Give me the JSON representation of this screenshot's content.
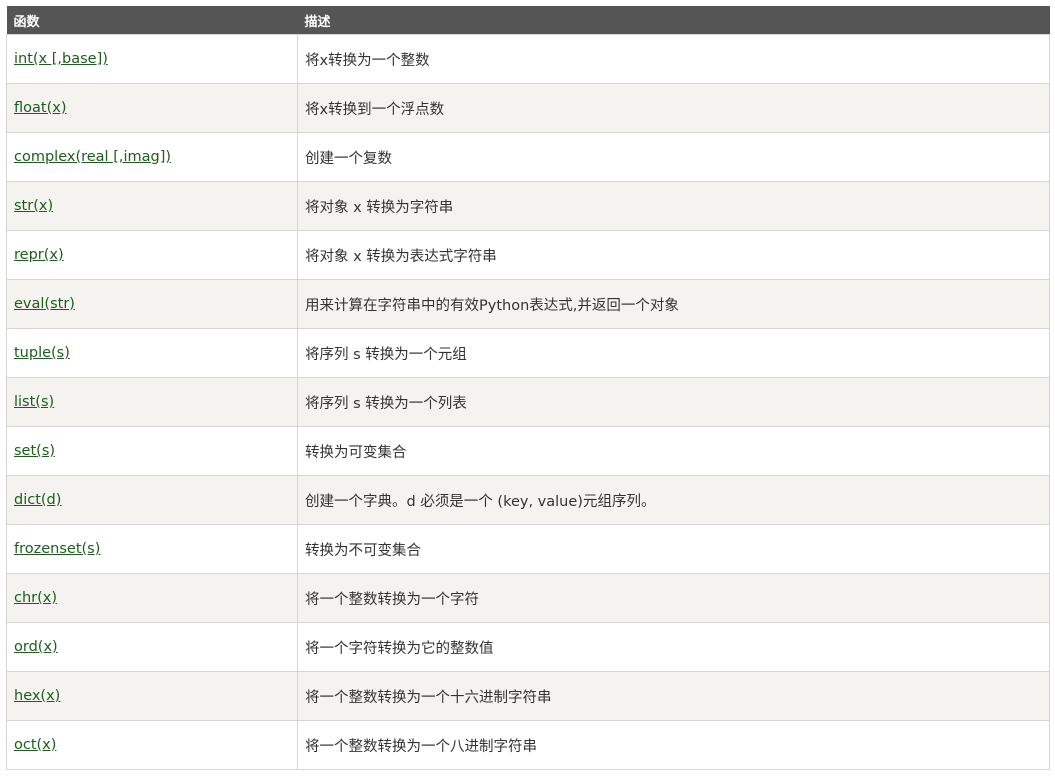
{
  "table": {
    "headers": {
      "function": "函数",
      "description": "描述"
    },
    "rows": [
      {
        "func": "int(x [,base])",
        "desc": "将x转换为一个整数"
      },
      {
        "func": "float(x)",
        "desc": "将x转换到一个浮点数"
      },
      {
        "func": "complex(real [,imag])",
        "desc": "创建一个复数"
      },
      {
        "func": "str(x)",
        "desc": "将对象 x 转换为字符串"
      },
      {
        "func": "repr(x)",
        "desc": "将对象 x 转换为表达式字符串"
      },
      {
        "func": "eval(str)",
        "desc": "用来计算在字符串中的有效Python表达式,并返回一个对象"
      },
      {
        "func": "tuple(s)",
        "desc": "将序列 s 转换为一个元组"
      },
      {
        "func": "list(s)",
        "desc": "将序列 s 转换为一个列表"
      },
      {
        "func": "set(s)",
        "desc": "转换为可变集合"
      },
      {
        "func": "dict(d)",
        "desc": "创建一个字典。d 必须是一个 (key, value)元组序列。"
      },
      {
        "func": "frozenset(s)",
        "desc": "转换为不可变集合"
      },
      {
        "func": "chr(x)",
        "desc": "将一个整数转换为一个字符"
      },
      {
        "func": "ord(x)",
        "desc": "将一个字符转换为它的整数值"
      },
      {
        "func": "hex(x)",
        "desc": "将一个整数转换为一个十六进制字符串"
      },
      {
        "func": "oct(x)",
        "desc": "将一个整数转换为一个八进制字符串"
      }
    ]
  }
}
